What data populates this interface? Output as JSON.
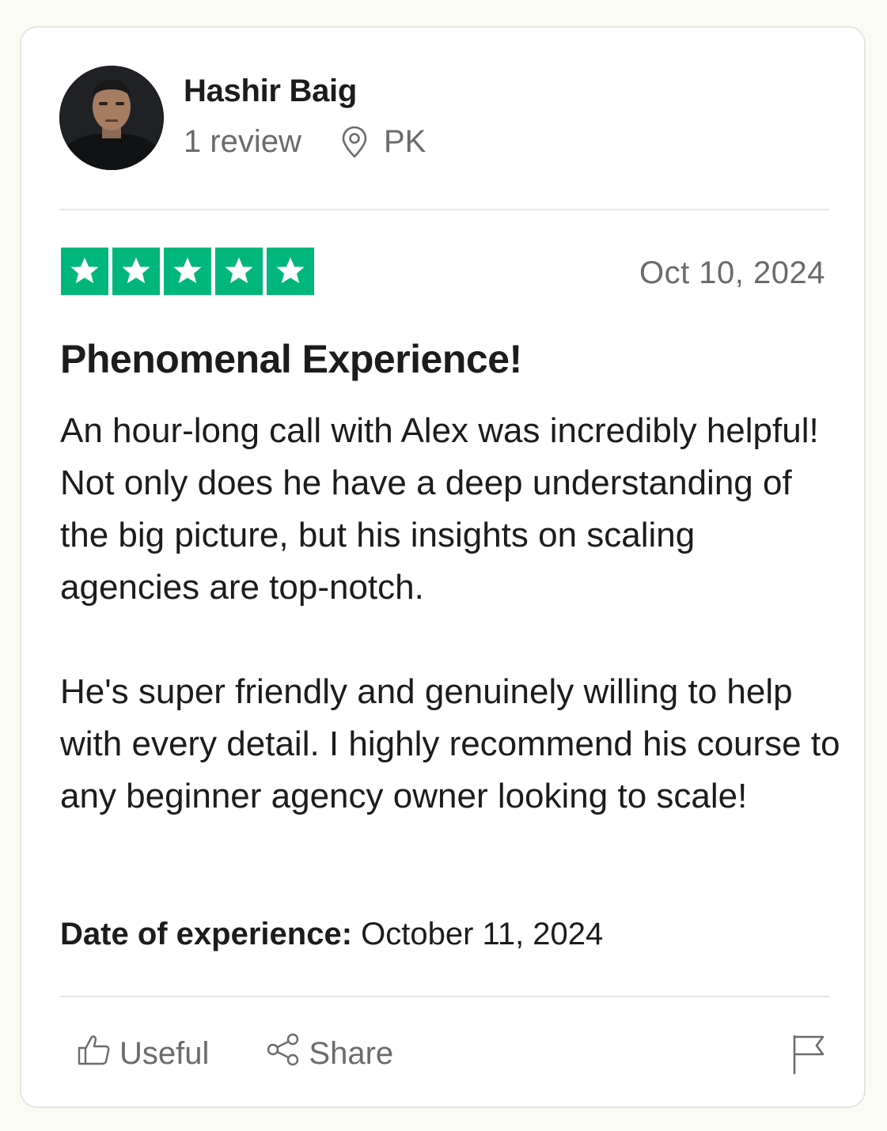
{
  "reviewer": {
    "name": "Hashir Baig",
    "review_count": "1 review",
    "location": "PK",
    "avatar_icon": "user-photo"
  },
  "review": {
    "rating": 5,
    "max_rating": 5,
    "star_color": "#00b67a",
    "date": "Oct 10, 2024",
    "title": "Phenomenal Experience!",
    "paragraphs": [
      "An hour-long call with Alex was incredibly helpful! Not only does he have a deep understanding of the big picture, but his insights on scaling agencies are top-notch.",
      "He's super friendly and genuinely willing to help with every detail. I highly recommend his course to any beginner agency owner looking to scale!"
    ],
    "experience_label": "Date of experience:",
    "experience_date": "October 11, 2024"
  },
  "actions": {
    "useful_label": "Useful",
    "share_label": "Share",
    "useful_icon": "thumbs-up-icon",
    "share_icon": "share-icon",
    "flag_icon": "flag-icon"
  }
}
